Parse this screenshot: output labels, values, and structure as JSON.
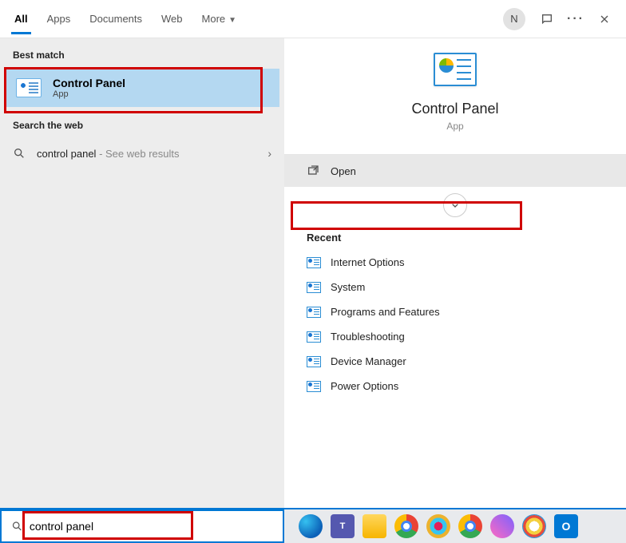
{
  "header": {
    "tabs": [
      "All",
      "Apps",
      "Documents",
      "Web",
      "More"
    ],
    "active_tab_index": 0,
    "avatar_letter": "N"
  },
  "left": {
    "best_match_label": "Best match",
    "result": {
      "title": "Control Panel",
      "subtitle": "App"
    },
    "search_web_label": "Search the web",
    "web_query": "control panel",
    "web_suffix": " - See web results"
  },
  "right": {
    "app_name": "Control Panel",
    "app_type": "App",
    "open_label": "Open",
    "recent_label": "Recent",
    "recent_items": [
      "Internet Options",
      "System",
      "Programs and Features",
      "Troubleshooting",
      "Device Manager",
      "Power Options"
    ]
  },
  "search": {
    "value": "control panel"
  }
}
